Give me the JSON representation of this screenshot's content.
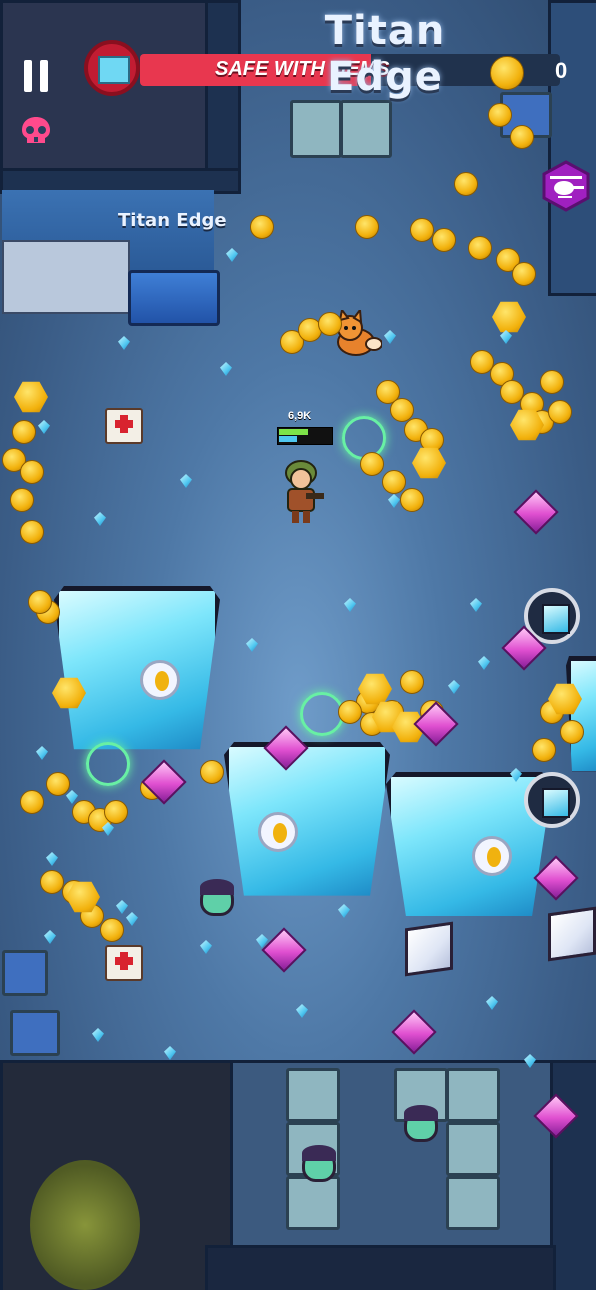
{
  "hud": {
    "title": "Titan Edge",
    "banner_text": "SAFE WITH GEMS",
    "gem_count": "0",
    "pause_icon": "pause-icon",
    "skull_icon": "skull-icon",
    "helicopter_icon": "helicopter-icon",
    "portal_icon": "crystal-portal-icon"
  },
  "player": {
    "power_label": "6,9K",
    "health_fraction": 0.55,
    "shield_fraction": 0.35
  },
  "poster": {
    "title": "Titan Edge"
  },
  "colors": {
    "banner_red": "#e8374f",
    "hud_dark": "#20324d",
    "coin_gold": "#f2b10c",
    "gem_blue": "#4fc7f0",
    "gem_pink": "#e04fd0",
    "crystal_cyan": "#7ee6fb",
    "skull_pink": "#ff4a8c",
    "heli_purple": "#a020c0"
  },
  "pickups": {
    "coin_icon": "gold-coin-icon",
    "gem_icon": "blue-gem-icon",
    "purple_gem_icon": "purple-gem-icon",
    "medkit_icon": "medkit-icon"
  }
}
